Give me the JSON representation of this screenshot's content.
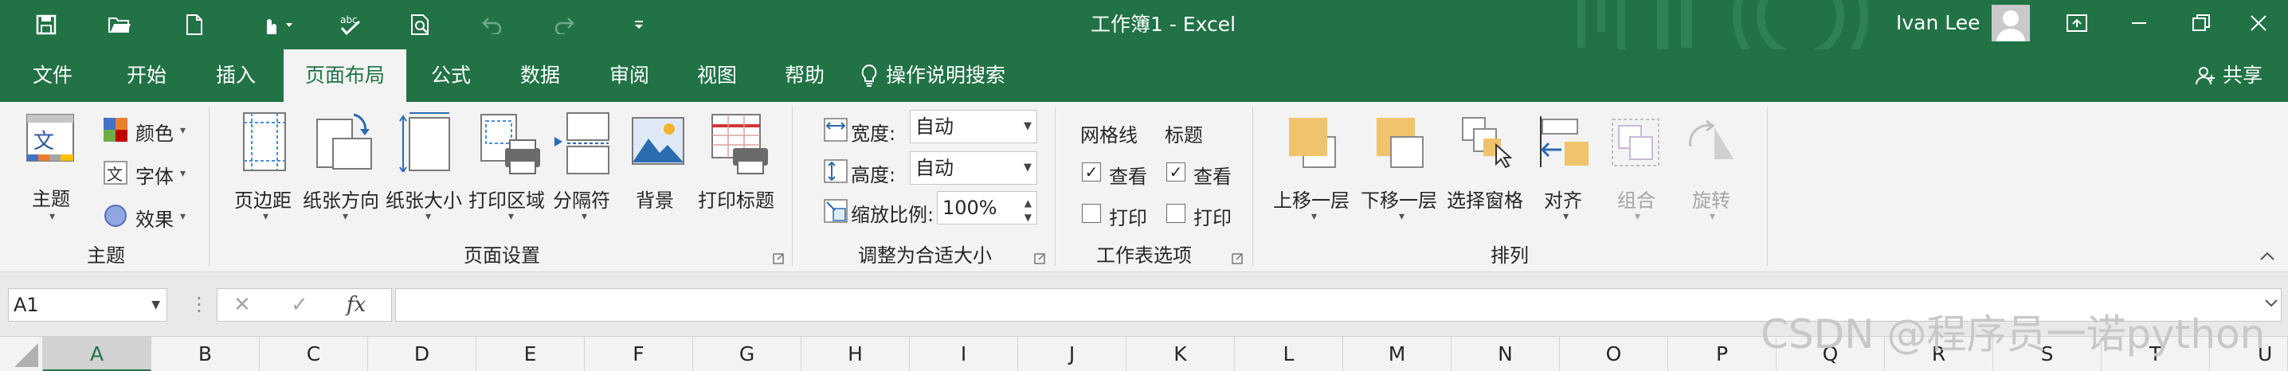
{
  "title_bar": {
    "title": "工作簿1  -  Excel",
    "user_name": "Ivan Lee"
  },
  "menu_tabs": [
    "文件",
    "开始",
    "插入",
    "页面布局",
    "公式",
    "数据",
    "审阅",
    "视图",
    "帮助"
  ],
  "active_tab": "页面布局",
  "tell_me": "操作说明搜索",
  "share": "共享",
  "ribbon": {
    "theme_group": {
      "theme": "主题",
      "colors": "颜色",
      "fonts": "字体",
      "effects": "效果",
      "label": "主题"
    },
    "page_setup_group": {
      "margins": "页边距",
      "orientation": "纸张方向",
      "size": "纸张大小",
      "print_area": "打印区域",
      "breaks": "分隔符",
      "background": "背景",
      "print_titles": "打印标题",
      "label": "页面设置"
    },
    "scale_group": {
      "width_label": "宽度:",
      "width_value": "自动",
      "height_label": "高度:",
      "height_value": "自动",
      "scale_label": "缩放比例:",
      "scale_value": "100%",
      "label": "调整为合适大小"
    },
    "sheet_options_group": {
      "gridlines": "网格线",
      "headings": "标题",
      "view": "查看",
      "print": "打印",
      "gridlines_view": true,
      "gridlines_print": false,
      "headings_view": true,
      "headings_print": false,
      "label": "工作表选项"
    },
    "arrange_group": {
      "bring_forward": "上移一层",
      "send_backward": "下移一层",
      "selection_pane": "选择窗格",
      "align": "对齐",
      "group": "组合",
      "rotate": "旋转",
      "label": "排列"
    }
  },
  "formula_bar": {
    "name_box": "A1",
    "fx": "fx",
    "formula": ""
  },
  "columns": [
    "A",
    "B",
    "C",
    "D",
    "E",
    "F",
    "G",
    "H",
    "I",
    "J",
    "K",
    "L",
    "M",
    "N",
    "O",
    "P",
    "Q",
    "R",
    "S",
    "T",
    "U"
  ],
  "selected_column": "A",
  "watermark": "CSDN @程序员一诺python",
  "colors": {
    "excel_green": "#217346",
    "ribbon_bg": "#f3f3f3"
  }
}
